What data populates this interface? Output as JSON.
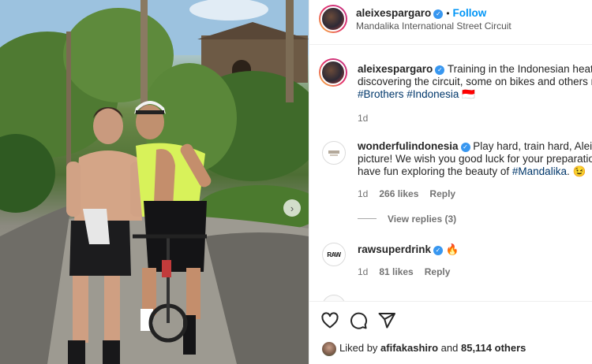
{
  "post": {
    "username": "aleixespargaro",
    "follow_label": "Follow",
    "location": "Mandalika International Street Circuit",
    "caption_line1": "Training in the Indonesian heat a",
    "caption_line2": "discovering the circuit, some on bikes and others r",
    "hashtag1": "#Brothers",
    "hashtag2": "#Indonesia",
    "flag": "🇮🇩",
    "caption_time": "1d"
  },
  "comments": [
    {
      "username": "wonderfulindonesia",
      "line1": "Play hard, train hard, Aleix.",
      "line2": "picture! We wish you good luck for your preparatio",
      "line3_prefix": "have fun exploring the beauty of",
      "line3_tag": "#Mandalika",
      "line3_suffix": ". 😉",
      "time": "1d",
      "likes": "266 likes",
      "reply_label": "Reply",
      "view_replies": "View replies (3)"
    },
    {
      "username": "rawsuperdrink",
      "text": "🔥",
      "time": "1d",
      "likes": "81 likes",
      "reply_label": "Reply"
    }
  ],
  "footer": {
    "liked_by_prefix": "Liked by",
    "liked_by_user": "afifakashiro",
    "liked_by_and": "and",
    "others": "85,114 others"
  },
  "icons": {
    "like": "heart-icon",
    "comment": "comment-icon",
    "share": "share-icon",
    "verified": "verified-badge-icon",
    "next": "chevron-right-icon"
  },
  "colors": {
    "link": "#0095f6",
    "hashtag": "#00376b",
    "verified": "#3897f0"
  }
}
